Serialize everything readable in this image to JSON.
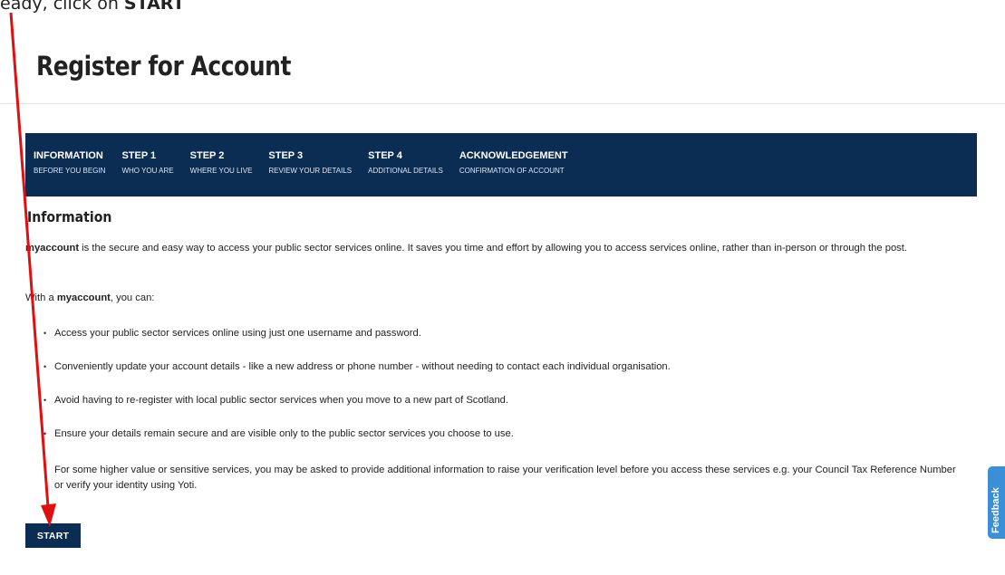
{
  "instruction": {
    "prefix": "eady, click on ",
    "emphasis": "START"
  },
  "page_title": "Register for Account",
  "steps": [
    {
      "label": "INFORMATION",
      "sub": "BEFORE YOU BEGIN"
    },
    {
      "label": "STEP 1",
      "sub": "WHO YOU ARE"
    },
    {
      "label": "STEP 2",
      "sub": "WHERE YOU LIVE"
    },
    {
      "label": "STEP 3",
      "sub": "REVIEW YOUR DETAILS"
    },
    {
      "label": "STEP 4",
      "sub": "ADDITIONAL DETAILS"
    },
    {
      "label": "ACKNOWLEDGEMENT",
      "sub": "CONFIRMATION OF ACCOUNT"
    }
  ],
  "section_title": "Information",
  "intro": {
    "brand": "myaccount",
    "text": " is the secure and easy way to access your public sector services online. It saves you time and effort by allowing you to access services online, rather than in-person or through the post."
  },
  "with_line": {
    "prefix": "With a ",
    "brand": "myaccount",
    "suffix": ", you can:"
  },
  "bullets": [
    "Access your public sector services online using just one username and password.",
    "Conveniently update your account details - like a new address or phone number - without needing to contact each individual organisation.",
    "Avoid having to re-register with local public sector services when you move to a new part of Scotland.",
    "Ensure your details remain secure and are visible only to the public sector services you choose to use."
  ],
  "note": "For some higher value or sensitive services, you may be asked to provide additional information to raise your verification level before you access these services e.g. your Council Tax Reference Number or verify your identity using Yoti.",
  "start_label": "START",
  "feedback_label": "Feedback",
  "colors": {
    "navy": "#0b2c53",
    "feedback": "#3a8fd6",
    "annotation": "#e01010"
  }
}
